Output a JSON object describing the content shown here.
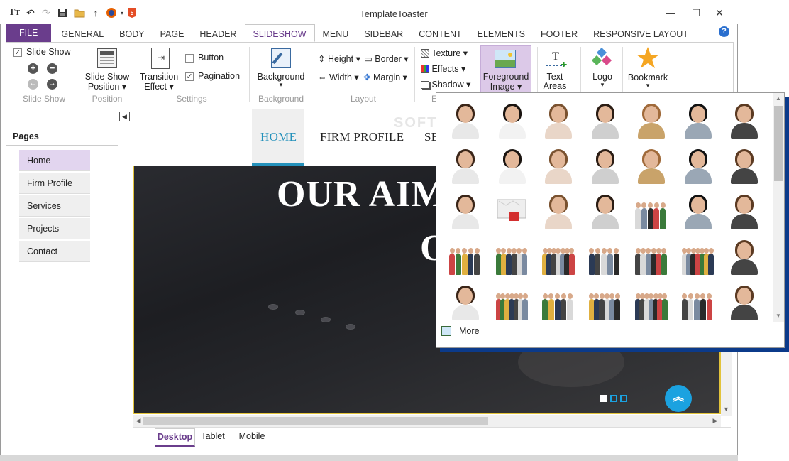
{
  "app": {
    "title": "TemplateToaster",
    "window_controls": {
      "minimize": "—",
      "maximize": "☐",
      "close": "✕"
    }
  },
  "ribbon_tabs": [
    "FILE",
    "GENERAL",
    "BODY",
    "PAGE",
    "HEADER",
    "SLIDESHOW",
    "MENU",
    "SIDEBAR",
    "CONTENT",
    "ELEMENTS",
    "FOOTER",
    "RESPONSIVE LAYOUT"
  ],
  "active_tab": "SLIDESHOW",
  "ribbon": {
    "slideshow_group": {
      "checkbox_label": "Slide Show",
      "checked": true,
      "group_label": "Slide Show"
    },
    "position_group": {
      "button_label_1": "Slide Show",
      "button_label_2": "Position",
      "group_label": "Position"
    },
    "settings_group": {
      "transition_1": "Transition",
      "transition_2": "Effect",
      "button_label": "Button",
      "button_checked": false,
      "pagination_label": "Pagination",
      "pagination_checked": true,
      "group_label": "Settings"
    },
    "background_group": {
      "button_label": "Background",
      "group_label": "Background"
    },
    "layout_group": {
      "height": "Height",
      "border": "Border",
      "width": "Width",
      "margin": "Margin",
      "group_label": "Layout"
    },
    "effects_group": {
      "texture": "Texture",
      "effects": "Effects",
      "shadow": "Shadow",
      "group_label": "E"
    },
    "foreground_group": {
      "label_1": "Foreground",
      "label_2": "Image"
    },
    "text_areas": {
      "label_1": "Text",
      "label_2": "Areas"
    },
    "logo": {
      "label": "Logo"
    },
    "bookmark": {
      "label": "Bookmark"
    }
  },
  "left_panel": {
    "title": "Pages",
    "pages": [
      "Home",
      "Firm Profile",
      "Services",
      "Projects",
      "Contact"
    ],
    "active_page": "Home"
  },
  "site_preview": {
    "nav": [
      "HOME",
      "FIRM PROFILE",
      "SE"
    ],
    "slide_title": "OUR AIM",
    "slide_sub": "O",
    "pagination_dots": 3,
    "active_dot": 1
  },
  "device_tabs": [
    "Desktop",
    "Tablet",
    "Mobile"
  ],
  "active_device": "Desktop",
  "gallery": {
    "rows": 5,
    "cols": 7,
    "more_label": "More"
  },
  "watermark": "SOFTPEDIA",
  "colors": {
    "accent_purple": "#6a3d8c",
    "nav_underline": "#2491bb",
    "slide_border": "#e2c33b",
    "scroll_button": "#1ba2e0",
    "gallery_shadow": "#0b3a8a"
  }
}
